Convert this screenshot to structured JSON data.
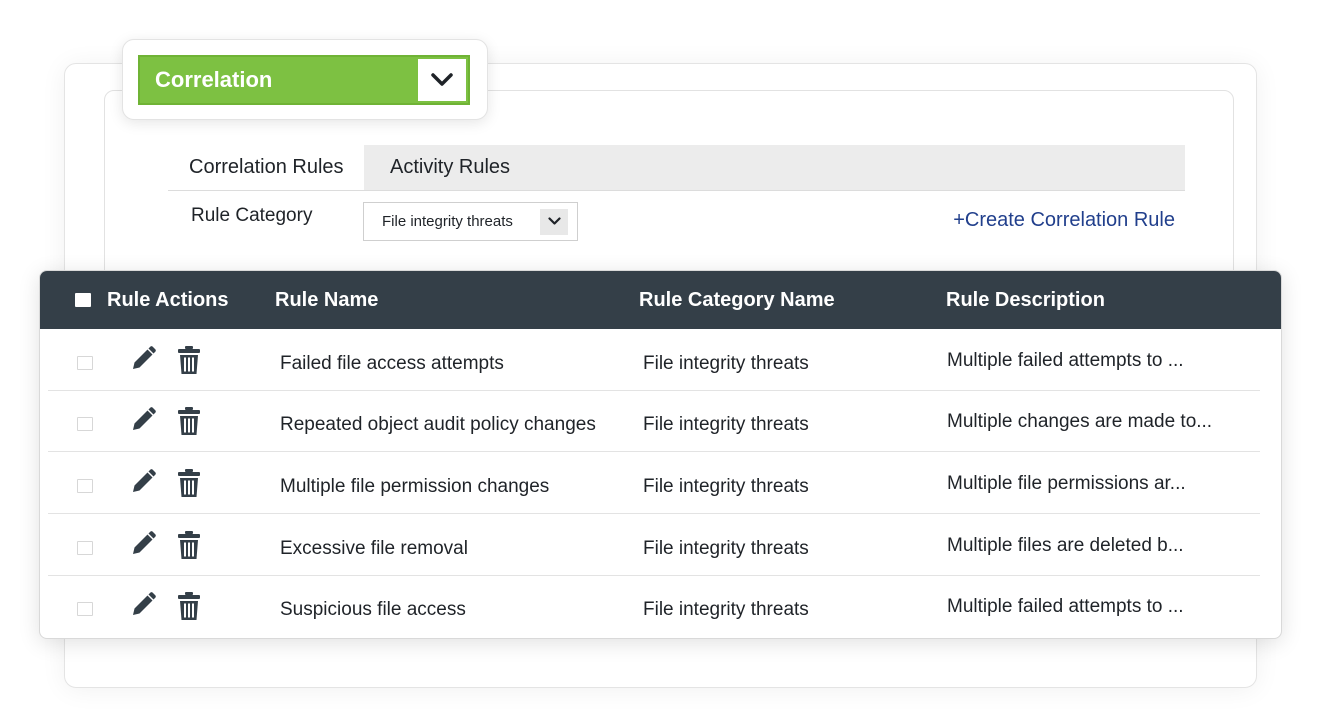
{
  "module": {
    "label": "Correlation"
  },
  "tabs": [
    {
      "label": "Correlation Rules"
    },
    {
      "label": "Activity Rules"
    }
  ],
  "filter": {
    "label": "Rule Category",
    "selected": "File integrity threats"
  },
  "create_link": "+Create Correlation Rule",
  "table": {
    "columns": [
      "Rule Actions",
      "Rule Name",
      "Rule Category Name",
      "Rule Description"
    ],
    "rows": [
      {
        "name": "Failed file access attempts",
        "category": "File integrity threats",
        "description": "Multiple failed attempts to ..."
      },
      {
        "name": "Repeated object audit policy changes",
        "category": "File integrity threats",
        "description": "Multiple changes are made to..."
      },
      {
        "name": "Multiple file permission changes",
        "category": "File integrity threats",
        "description": "Multiple file permissions ar..."
      },
      {
        "name": "Excessive file removal",
        "category": "File integrity threats",
        "description": "Multiple files are deleted b..."
      },
      {
        "name": "Suspicious file access",
        "category": "File integrity threats",
        "description": "Multiple failed attempts to ..."
      }
    ]
  },
  "icons": [
    "chevron-down-icon",
    "pencil-icon",
    "trash-icon"
  ],
  "colors": {
    "accent_green": "#7dc142",
    "table_header": "#343f48",
    "link": "#213f8c",
    "active_tab_bg": "#ececec"
  }
}
